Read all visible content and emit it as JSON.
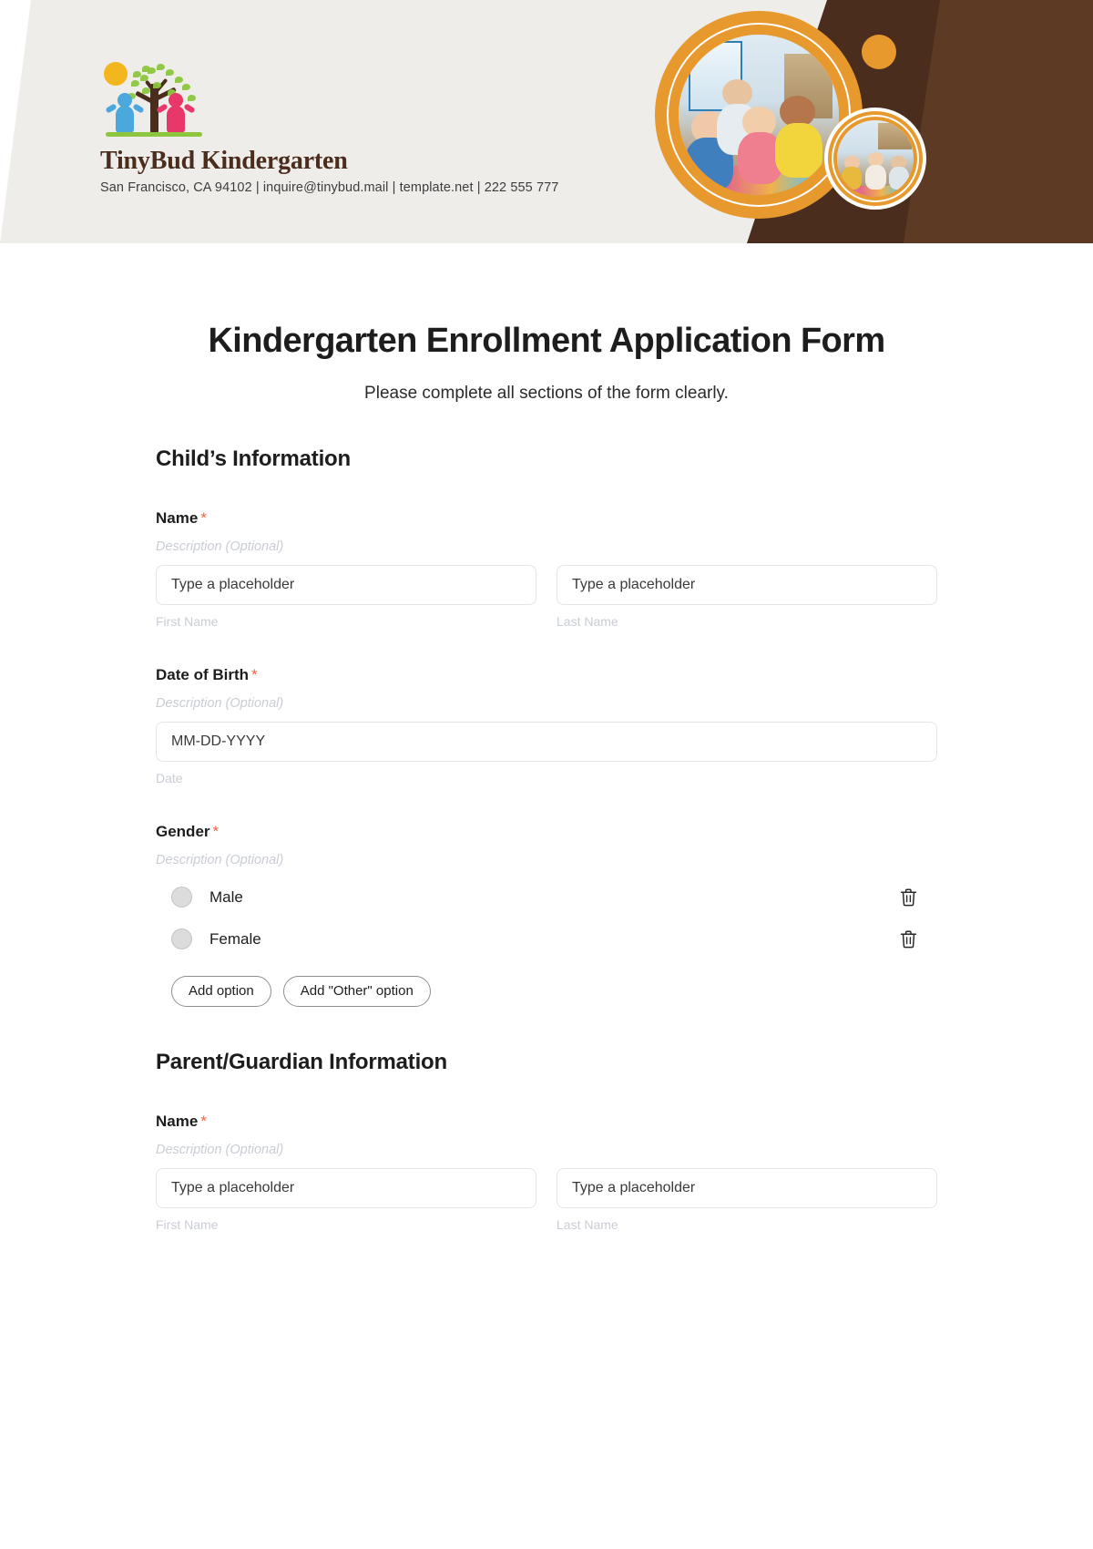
{
  "header": {
    "logo": {
      "icon_name": "tree-with-children-logo",
      "brand_name": "TinyBud Kindergarten",
      "contact_line": "San Francisco, CA 94102 | inquire@tinybud.mail | template.net | 222 555 777"
    },
    "photo_big_alt": "children cheering in classroom",
    "photo_small_alt": "children raising hands",
    "colors": {
      "band_background": "#efedea",
      "brown_wedge": "#4a2d1c",
      "accent_orange": "#e8992d",
      "brand_text": "#4a2d1c"
    }
  },
  "form": {
    "title": "Kindergarten Enrollment Application Form",
    "subtitle": "Please complete all sections of the form clearly.",
    "required_marker": "*",
    "description_placeholder": "Description (Optional)",
    "sections": [
      {
        "heading": "Child’s Information",
        "fields": [
          {
            "label": "Name",
            "required": true,
            "description": "Description (Optional)",
            "type": "name",
            "inputs": [
              {
                "placeholder": "Type a placeholder",
                "sub_label": "First Name"
              },
              {
                "placeholder": "Type a placeholder",
                "sub_label": "Last Name"
              }
            ]
          },
          {
            "label": "Date of Birth",
            "required": true,
            "description": "Description (Optional)",
            "type": "date",
            "inputs": [
              {
                "placeholder": "MM-DD-YYYY",
                "sub_label": "Date"
              }
            ]
          },
          {
            "label": "Gender",
            "required": true,
            "description": "Description (Optional)",
            "type": "radio",
            "options": [
              {
                "label": "Male",
                "delete_icon": "trash-icon"
              },
              {
                "label": "Female",
                "delete_icon": "trash-icon"
              }
            ],
            "buttons": [
              {
                "label": "Add option"
              },
              {
                "label": "Add \"Other\" option"
              }
            ]
          }
        ]
      },
      {
        "heading": "Parent/Guardian Information",
        "fields": [
          {
            "label": "Name",
            "required": true,
            "description": "Description (Optional)",
            "type": "name",
            "inputs": [
              {
                "placeholder": "Type a placeholder",
                "sub_label": "First Name"
              },
              {
                "placeholder": "Type a placeholder",
                "sub_label": "Last Name"
              }
            ]
          }
        ]
      }
    ]
  }
}
